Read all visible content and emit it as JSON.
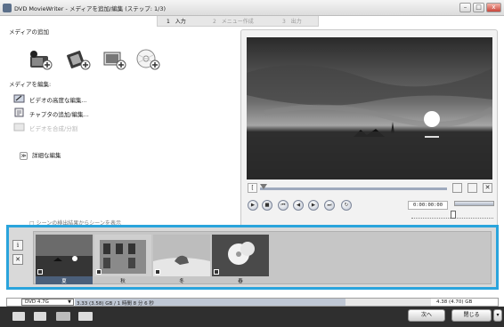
{
  "window": {
    "title": "DVD MovieWriter - メディアを追加/編集 (ステップ: 1/3)",
    "minimize_glyph": "–",
    "maximize_glyph": "□",
    "close_glyph": "x"
  },
  "steps": [
    {
      "num": "1",
      "label": "入力",
      "active": true
    },
    {
      "num": "2",
      "label": "メニュー作成",
      "active": false
    },
    {
      "num": "3",
      "label": "出力",
      "active": false
    }
  ],
  "media_add": {
    "label": "メディアの追加",
    "icons": [
      "add-video-camera-icon",
      "add-video-file-icon",
      "add-image-icon",
      "add-disc-icon"
    ]
  },
  "media_edit": {
    "label": "メディアを編集:",
    "items": [
      {
        "label": "ビデオの高度な編集...",
        "enabled": true,
        "icon": "video-edit-icon"
      },
      {
        "label": "チャプタの追加/編集...",
        "enabled": true,
        "icon": "chapter-edit-icon"
      },
      {
        "label": "ビデオを合成/分割",
        "enabled": false,
        "icon": "merge-split-icon"
      }
    ],
    "advanced_label": "詳細な編集",
    "advanced_glyph": "≫"
  },
  "scene_note": "□ シーンの検出結果からシーンを表示",
  "preview": {
    "time": "0:00:00:00",
    "buttons": [
      "play-icon",
      "stop-icon",
      "previous-icon",
      "rewind-icon",
      "forward-icon",
      "next-icon",
      "repeat-icon"
    ],
    "button_glyphs": [
      "▶",
      "■",
      "⏮",
      "◀",
      "▶",
      "⏭",
      "↻"
    ]
  },
  "timeline": {
    "info_glyph": "i",
    "collapse_glyph": "✕",
    "clips": [
      {
        "label": "夏",
        "selected": true
      },
      {
        "label": "秋",
        "selected": false
      },
      {
        "label": "冬",
        "selected": false
      },
      {
        "label": "春",
        "selected": false
      }
    ]
  },
  "status": {
    "disc": "DVD 4.7G",
    "used_text": "3.33 (3.58) GB / 1 時間 8 分 6 秒",
    "total_text": "4.38 (4.70) GB",
    "used_fraction": 0.76
  },
  "bottom": {
    "next_label": "次へ",
    "close_label": "閉じる"
  },
  "colors": {
    "selection_border": "#2aa4dc",
    "bottom_bar": "#2f2f2f"
  }
}
